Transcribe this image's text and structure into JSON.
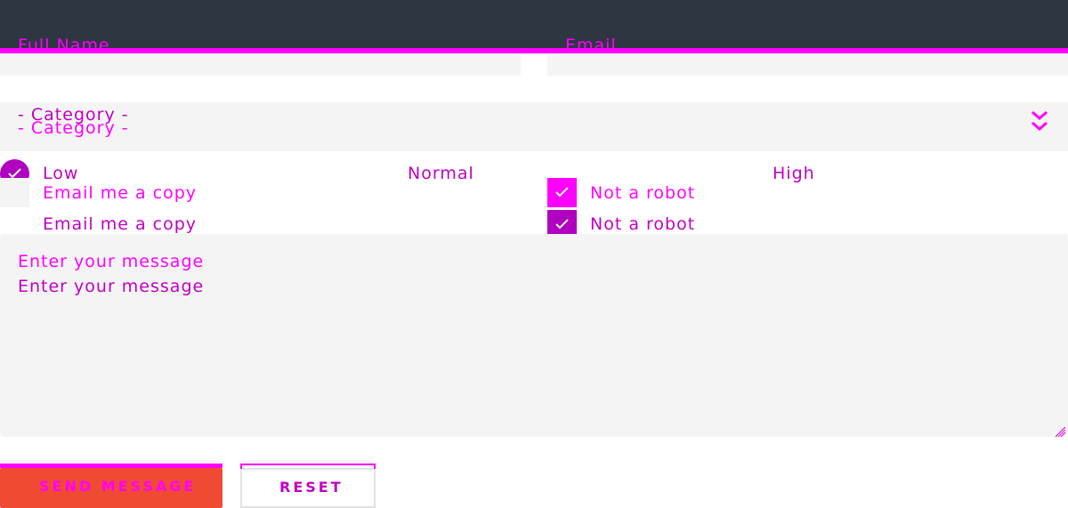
{
  "form": {
    "full_name_placeholder": "Full Name",
    "email_placeholder": "Email",
    "category_selected": "- Category -",
    "category_selected_ghost": "- Category -",
    "priority": {
      "options": [
        "Low",
        "Normal",
        "High"
      ],
      "selected": "Low"
    },
    "email_copy_label": "Email me a copy",
    "email_copy_label_ghost": "Email me a copy",
    "not_robot_label": "Not a robot",
    "not_robot_label_ghost": "Not a robot",
    "message_placeholder": "Enter your message",
    "message_placeholder_ghost": "Enter your message",
    "send_label": "SEND MESSAGE",
    "reset_label": "RESET"
  },
  "colors": {
    "topbar": "#2e3642",
    "accent": "#ff00ff",
    "accent_dark": "#c000c0",
    "field_bg": "#f4f4f4",
    "send_button": "#f04a32"
  },
  "icons": {
    "select_arrow": "double-chevron-down-icon",
    "check": "check-icon",
    "resize": "resize-handle-icon"
  }
}
